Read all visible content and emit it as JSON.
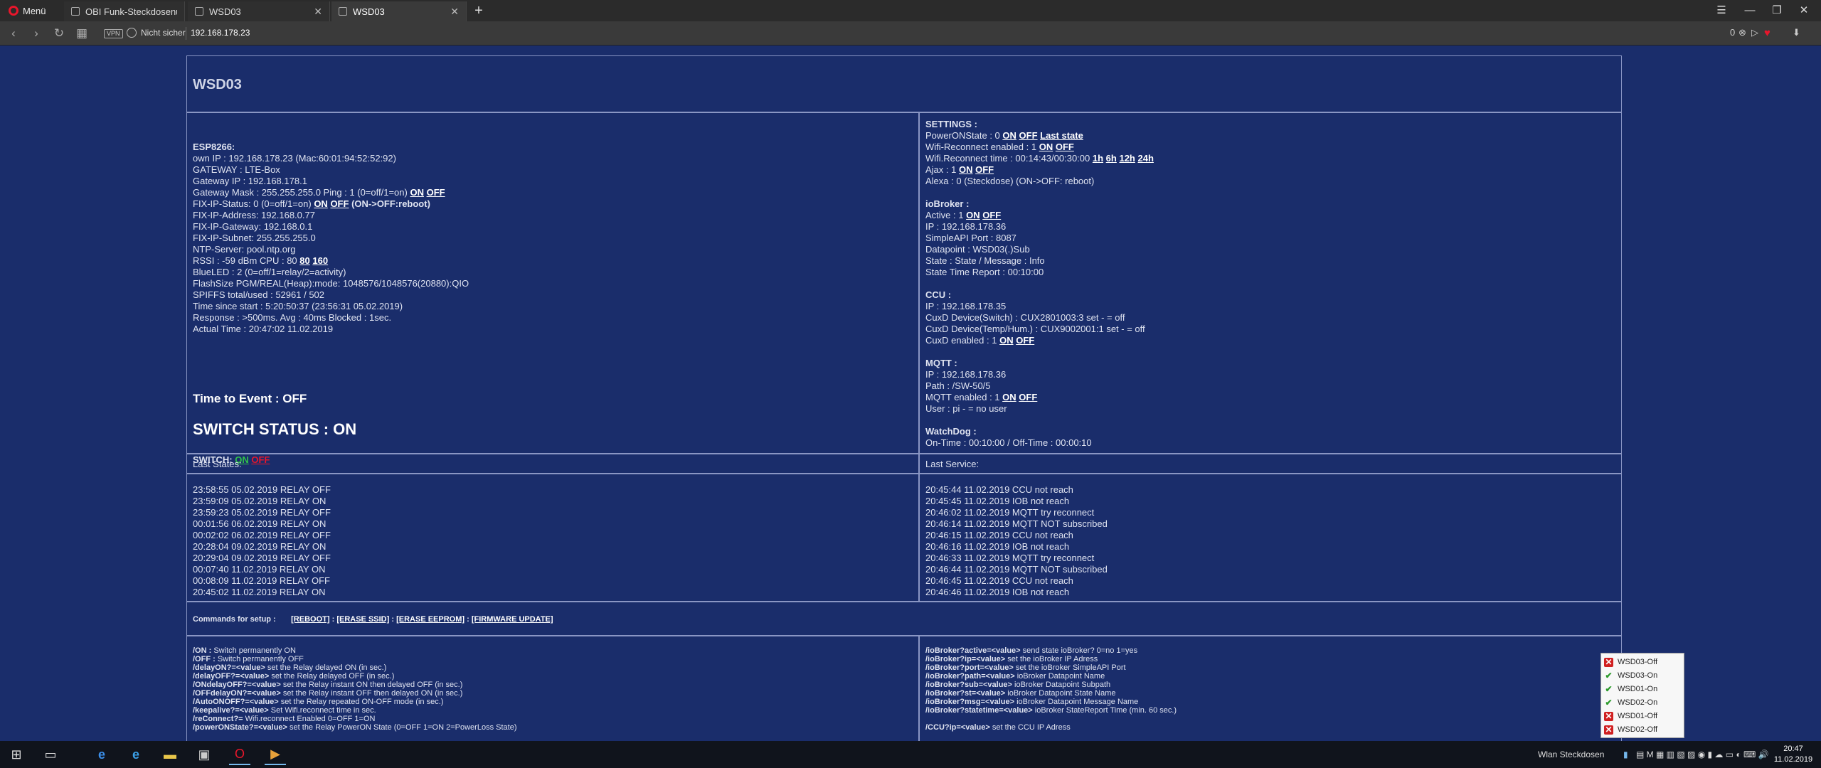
{
  "browser": {
    "menu_label": "Menü",
    "tabs": [
      {
        "label": "OBI Funk-Steckdosenumb"
      },
      {
        "label": "WSD03"
      },
      {
        "label": "WSD03"
      }
    ],
    "vpn_label": "VPN",
    "security_label": "Nicht sicher",
    "url": "192.168.178.23",
    "badge_count": "0"
  },
  "page": {
    "title": "WSD03",
    "esp": {
      "heading": "ESP8266:",
      "own_ip": "own IP : 192.168.178.23 (Mac:60:01:94:52:52:92)",
      "gateway": "GATEWAY : LTE-Box",
      "gateway_ip": "Gateway IP : 192.168.178.1",
      "gateway_mask": "Gateway Mask : 255.255.255.0 Ping : 1 (0=off/1=on)",
      "fix_ip_status": "FIX-IP-Status: 0 (0=off/1=on)",
      "fix_ip_note": "(ON->OFF:reboot)",
      "fix_ip_address": "FIX-IP-Address: 192.168.0.77",
      "fix_ip_gateway": "FIX-IP-Gateway: 192.168.0.1",
      "fix_ip_subnet": "FIX-IP-Subnet: 255.255.255.0",
      "ntp": "NTP-Server: pool.ntp.org",
      "rssi": "RSSI : -59 dBm CPU : 80",
      "cpu_80": "80",
      "cpu_160": "160",
      "blueled": "BlueLED : 2 (0=off/1=relay/2=activity)",
      "flash": "FlashSize PGM/REAL(Heap):mode: 1048576/1048576(20880):QIO",
      "spiffs": "SPIFFS total/used : 52961 / 502",
      "since_start": "Time since start : 5:20:50:37 (23:56:31 05.02.2019)",
      "response": "Response : >500ms. Avg : 40ms Blocked : 1sec.",
      "actual_time": "Actual Time : 20:47:02 11.02.2019"
    },
    "time_to_event": "Time to Event : OFF",
    "switch_status": "SWITCH STATUS : ON",
    "switch_label": "SWITCH:",
    "on": "ON",
    "off": "OFF",
    "settings": {
      "heading": "SETTINGS :",
      "power_on_state": "PowerONState : 0",
      "last_state": "Last state",
      "wifi_reconnect": "Wifi-Reconnect enabled : 1",
      "wifi_reconnect_time": "Wifi.Reconnect time : 00:14:43/00:30:00",
      "h1": "1h",
      "h6": "6h",
      "h12": "12h",
      "h24": "24h",
      "ajax": "Ajax : 1",
      "alexa": "Alexa : 0 (Steckdose) (ON->OFF: reboot)"
    },
    "iobroker": {
      "heading": "ioBroker :",
      "active": "Active : 1",
      "ip": "IP : 192.168.178.36",
      "port": "SimpleAPI Port : 8087",
      "datapoint": "Datapoint : WSD03(.)Sub",
      "state": "State : State / Message : Info",
      "report": "State Time Report : 00:10:00"
    },
    "ccu": {
      "heading": "CCU :",
      "ip": "IP : 192.168.178.35",
      "switch": "CuxD Device(Switch) : CUX2801003:3 set - = off",
      "temp": "CuxD Device(Temp/Hum.) : CUX9002001:1 set - = off",
      "enabled": "CuxD enabled : 1"
    },
    "mqtt": {
      "heading": "MQTT :",
      "ip": "IP : 192.168.178.36",
      "path": "Path : /SW-50/5",
      "enabled": "MQTT enabled : 1",
      "user": "User : pi - = no user"
    },
    "watchdog": {
      "heading": "WatchDog :",
      "times": "On-Time : 00:10:00 / Off-Time : 00:00:10"
    },
    "last_states_label": "Last States:",
    "last_states": [
      "23:58:55 05.02.2019 RELAY OFF",
      "23:59:09 05.02.2019 RELAY ON",
      "23:59:23 05.02.2019 RELAY OFF",
      "00:01:56 06.02.2019 RELAY ON",
      "00:02:02 06.02.2019 RELAY OFF",
      "20:28:04 09.02.2019 RELAY ON",
      "20:29:04 09.02.2019 RELAY OFF",
      "00:07:40 11.02.2019 RELAY ON",
      "00:08:09 11.02.2019 RELAY OFF",
      "20:45:02 11.02.2019 RELAY ON"
    ],
    "last_service_label": "Last Service:",
    "last_service": [
      "20:45:44 11.02.2019 CCU not reach",
      "20:45:45 11.02.2019 IOB not reach",
      "20:46:02 11.02.2019 MQTT try reconnect",
      "20:46:14 11.02.2019 MQTT NOT subscribed",
      "20:46:15 11.02.2019 CCU not reach",
      "20:46:16 11.02.2019 IOB not reach",
      "20:46:33 11.02.2019 MQTT try reconnect",
      "20:46:44 11.02.2019 MQTT NOT subscribed",
      "20:46:45 11.02.2019 CCU not reach",
      "20:46:46 11.02.2019 IOB not reach"
    ],
    "commands_label": "Commands for setup :",
    "cmd_reboot": "[REBOOT]",
    "cmd_erase_ssid": "[ERASE SSID]",
    "cmd_erase_eeprom": "[ERASE EEPROM]",
    "cmd_firmware": "[FIRMWARE UPDATE]",
    "cmd_sep": ":",
    "help_left": [
      {
        "k": "/ON :",
        "v": "Switch permanently ON"
      },
      {
        "k": "/OFF :",
        "v": "Switch permanently OFF"
      },
      {
        "k": "/delayON?=<value>",
        "v": "set the Relay delayed ON (in sec.)"
      },
      {
        "k": "/delayOFF?=<value>",
        "v": "set the Relay delayed OFF (in sec.)"
      },
      {
        "k": "/ONdelayOFF?=<value>",
        "v": "set the Relay instant ON then delayed OFF (in sec.)"
      },
      {
        "k": "/OFFdelayON?=<value>",
        "v": "set the Relay instant OFF then delayed ON (in sec.)"
      },
      {
        "k": "/AutoONOFF?=<value>",
        "v": "set the Relay repeated ON-OFF mode (in sec.)"
      },
      {
        "k": "/keepalive?=<value>",
        "v": "Set Wifi.reconnect time in sec."
      },
      {
        "k": "/reConnect?=",
        "v": "Wifi.reconnect Enabled 0=OFF 1=ON"
      },
      {
        "k": "/powerONState?=<value>",
        "v": "set the Relay PowerON State (0=OFF 1=ON 2=PowerLoss State)"
      }
    ],
    "help_right": [
      {
        "k": "/ioBroker?active=<value>",
        "v": "send state ioBroker? 0=no 1=yes"
      },
      {
        "k": "/ioBroker?ip=<value>",
        "v": "set the ioBroker IP Adress"
      },
      {
        "k": "/ioBroker?port=<value>",
        "v": "set the ioBroker SimpleAPI Port"
      },
      {
        "k": "/ioBroker?path=<value>",
        "v": "ioBroker Datapoint Name"
      },
      {
        "k": "/ioBroker?sub=<value>",
        "v": "ioBroker Datapoint Subpath"
      },
      {
        "k": "/ioBroker?st=<value>",
        "v": "ioBroker Datapoint State Name"
      },
      {
        "k": "/ioBroker?msg=<value>",
        "v": "ioBroker Datapoint Message Name"
      },
      {
        "k": "/ioBroker?statetime=<value>",
        "v": "ioBroker StateReport Time (min. 60 sec.)"
      },
      {
        "k": "",
        "v": ""
      },
      {
        "k": "/CCU?ip=<value>",
        "v": "set the CCU IP Adress"
      }
    ]
  },
  "popup": {
    "items": [
      {
        "label": "WSD03-Off",
        "status": "error"
      },
      {
        "label": "WSD03-On",
        "status": "ok"
      },
      {
        "label": "WSD01-On",
        "status": "ok"
      },
      {
        "label": "WSD02-On",
        "status": "ok"
      },
      {
        "label": "WSD01-Off",
        "status": "error"
      },
      {
        "label": "WSD02-Off",
        "status": "error"
      }
    ]
  },
  "taskbar": {
    "tray_label": "Wlan Steckdosen",
    "time": "20:47",
    "date": "11.02.2019"
  },
  "colors": {
    "page_bg": "#1a2d6b",
    "on": "#31c24a",
    "off": "#e8162b",
    "accent": "#e8162b"
  }
}
